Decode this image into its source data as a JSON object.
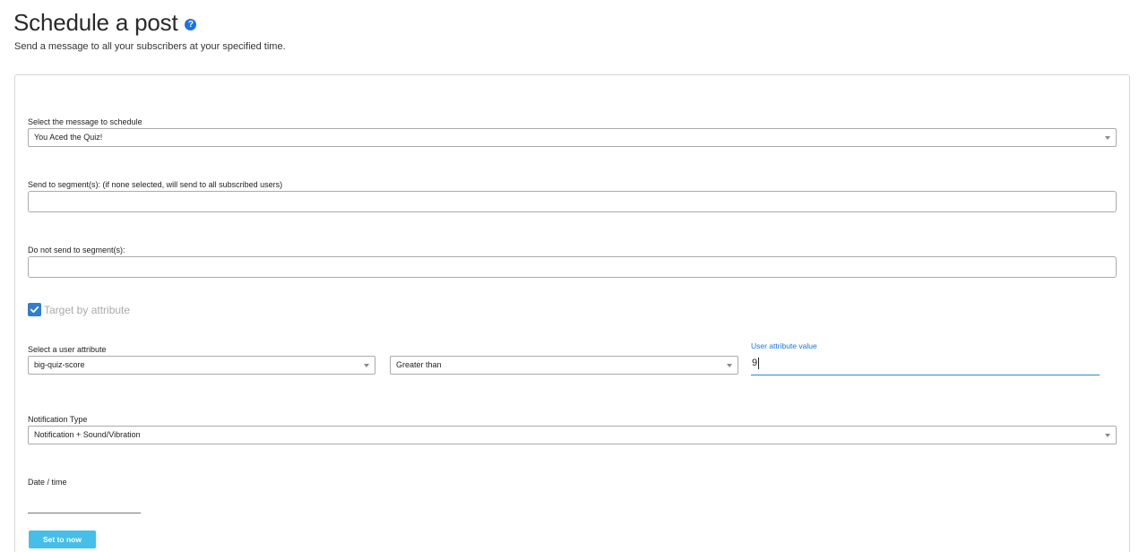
{
  "header": {
    "title": "Schedule a post",
    "help_icon": "question-circle",
    "subtitle": "Send a message to all your subscribers at your specified time."
  },
  "form": {
    "message": {
      "label": "Select the message to schedule",
      "value": "You Aced the Quiz!"
    },
    "segments_include": {
      "label": "Send to segment(s): (if none selected, will send to all subscribed users)",
      "value": ""
    },
    "segments_exclude": {
      "label": "Do not send to segment(s):",
      "value": ""
    },
    "target_by_attribute": {
      "label": "Target by attribute",
      "checked": true
    },
    "user_attribute": {
      "label": "Select a user attribute",
      "value": "big-quiz-score",
      "operator": "Greater than",
      "value_label": "User attribute value",
      "attr_value": "9"
    },
    "notification_type": {
      "label": "Notification Type",
      "value": "Notification + Sound/Vibration"
    },
    "date_time": {
      "label": "Date / time",
      "value": ""
    },
    "set_now_label": "Set to now"
  },
  "colors": {
    "accent": "#1a73e8",
    "checkbox": "#2f7fd1",
    "button": "#45bfe9"
  }
}
